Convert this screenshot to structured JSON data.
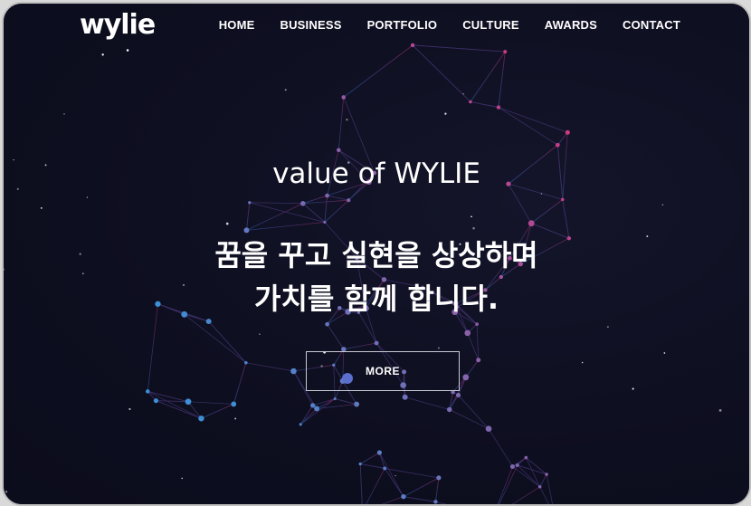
{
  "brand": {
    "logo_text": "wylie"
  },
  "nav": {
    "items": [
      {
        "label": "HOME"
      },
      {
        "label": "BUSINESS"
      },
      {
        "label": "PORTFOLIO"
      },
      {
        "label": "CULTURE"
      },
      {
        "label": "AWARDS"
      },
      {
        "label": "CONTACT"
      }
    ]
  },
  "hero": {
    "subtitle": "value of WYLIE",
    "title_line1": "꿈을 꾸고 실현을 상상하며",
    "title_line2": "가치를 함께 합니다.",
    "more_label": "MORE"
  },
  "colors": {
    "background": "#0d0e1f",
    "accent_pink": "#d6337d",
    "accent_blue": "#3d8fd6",
    "text": "#ffffff"
  }
}
